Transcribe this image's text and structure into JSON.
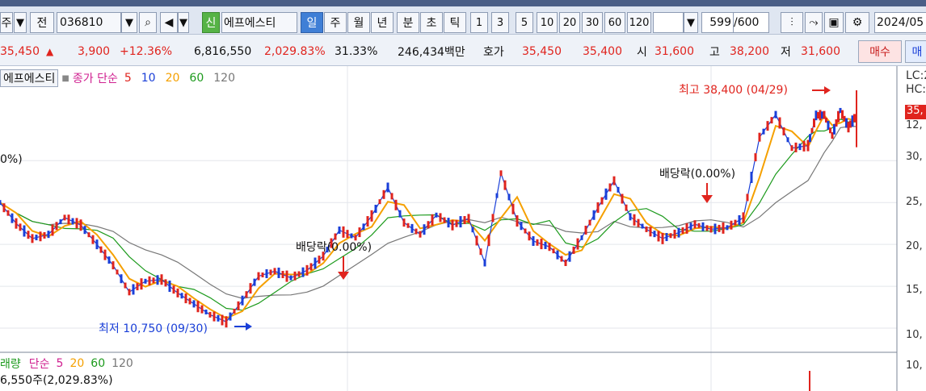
{
  "toolbar": {
    "market_label": "주",
    "prev_label": "전",
    "code": "036810",
    "new_badge": "신",
    "stock_name": "에프에스티",
    "periods": [
      "일",
      "주",
      "월",
      "년",
      "분",
      "초",
      "틱"
    ],
    "selected_period": "일",
    "counts": [
      "1",
      "3",
      "5",
      "10",
      "20",
      "30",
      "60",
      "120"
    ],
    "count_current": "599",
    "count_total": "/600",
    "date": "2024/05"
  },
  "quote": {
    "price": "35,450",
    "change_arrow": "▲",
    "change": "3,900",
    "change_pct": "+12.36%",
    "volume": "6,816,550",
    "volume_pct": "2,029.83%",
    "turnover": "31.33%",
    "amount": "246,434백만",
    "bid_label": "호가",
    "ask_price": "35,450",
    "bid_price": "35,400",
    "open_label": "시",
    "open": "31,600",
    "high_label": "고",
    "high": "38,200",
    "low_label": "저",
    "low": "31,600",
    "buy_label": "매수",
    "sell_label": "매"
  },
  "legend": {
    "name": "에프에스티",
    "type": "종가 단순",
    "periods": [
      "5",
      "10",
      "20",
      "60",
      "120"
    ],
    "colors": [
      "#e0241e",
      "#1a3fd8",
      "#f5a000",
      "#1c9a1c",
      "#777777"
    ]
  },
  "volume_legend": {
    "name": "래량",
    "type": "단순",
    "periods": [
      "5",
      "20",
      "60",
      "120"
    ],
    "value_text": "6,550주(2,029.83%)"
  },
  "annotations": {
    "high": "최고 38,400 (04/29)",
    "low": "최저 10,750 (09/30)",
    "dividend1": "배당락(0.00%)",
    "dividend2": "배당락(0.00%)",
    "left_pct": "0%)"
  },
  "axis": {
    "lc_label": "LC:2",
    "hc_label": "HC:",
    "price_tag": "35,",
    "price_tag2": "12,",
    "ticks": [
      "30,",
      "25,",
      "20,",
      "15,",
      "10,",
      "10,"
    ]
  },
  "chart_data": {
    "type": "line",
    "series": [
      {
        "name": "종가",
        "color": "#e0241e",
        "x": [
          0,
          20,
          40,
          60,
          80,
          100,
          120,
          140,
          160,
          180,
          200,
          220,
          240,
          260,
          280,
          300,
          320,
          340,
          360,
          380,
          400,
          420,
          440,
          460,
          480,
          500,
          520,
          540,
          560,
          580,
          600,
          620,
          640,
          660,
          680,
          700,
          720,
          740,
          760,
          780,
          800,
          820,
          840,
          860,
          880,
          900,
          920,
          940,
          960,
          980,
          1000,
          1010,
          1020,
          1030,
          1040,
          1050,
          1060
        ],
        "y": [
          25000,
          22500,
          20700,
          21200,
          23200,
          22300,
          20000,
          17500,
          14300,
          15600,
          15800,
          14200,
          12900,
          11600,
          10750,
          13300,
          16200,
          16800,
          16000,
          16900,
          18600,
          21700,
          20800,
          23400,
          26800,
          22600,
          21200,
          23500,
          22300,
          23100,
          17800,
          28500,
          22800,
          20400,
          19700,
          17800,
          20800,
          24400,
          27600,
          23300,
          21800,
          20700,
          21400,
          22400,
          21800,
          22000,
          23200,
          32800,
          35500,
          31500,
          31800,
          35400,
          35450,
          33000,
          36000,
          34000,
          35450
        ]
      }
    ],
    "ylim": [
      10000,
      38400
    ],
    "grid": true
  }
}
